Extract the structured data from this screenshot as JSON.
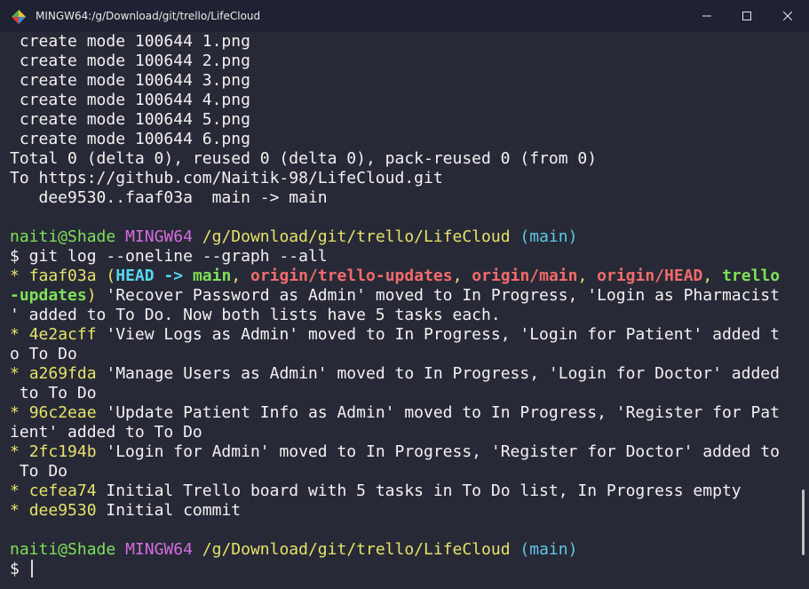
{
  "window": {
    "title": "MINGW64:/g/Download/git/trello/LifeCloud",
    "controls": {
      "minimize": "minimize",
      "maximize": "maximize",
      "close": "close"
    }
  },
  "terminal": {
    "plain_top": [
      " create mode 100644 1.png",
      " create mode 100644 2.png",
      " create mode 100644 3.png",
      " create mode 100644 4.png",
      " create mode 100644 5.png",
      " create mode 100644 6.png",
      "Total 0 (delta 0), reused 0 (delta 0), pack-reused 0 (from 0)",
      "To https://github.com/Naitik-98/LifeCloud.git",
      "   dee9530..faaf03a  main -> main"
    ],
    "prompt1": {
      "user": "naiti@Shade",
      "env": "MINGW64",
      "path": "/g/Download/git/trello/LifeCloud",
      "branch": "(main)"
    },
    "command": "$ git log --oneline --graph --all",
    "log": {
      "c1": {
        "star": "* ",
        "hash": "faaf03a",
        "open": " (",
        "head": "HEAD",
        "arrow": " -> ",
        "main": "main",
        "sep1": ", ",
        "r1": "origin/trello-updates",
        "sep2": ", ",
        "r2": "origin/main",
        "sep3": ", ",
        "r3": "origin/HEAD",
        "sep4": ", ",
        "trello_a": "trello",
        "trello_b": "-updates",
        "close": ")",
        "msg_a": " 'Recover Password as Admin' moved to In Progress, 'Login as Pharmacist",
        "msg_b": "' added to To Do. Now both lists have 5 tasks each."
      },
      "c2": {
        "star": "* ",
        "hash": "4e2acff",
        "msg_a": " 'View Logs as Admin' moved to In Progress, 'Login for Patient' added t",
        "msg_b": "o To Do"
      },
      "c3": {
        "star": "* ",
        "hash": "a269fda",
        "msg_a": " 'Manage Users as Admin' moved to In Progress, 'Login for Doctor' added",
        "msg_b": " to To Do"
      },
      "c4": {
        "star": "* ",
        "hash": "96c2eae",
        "msg_a": " 'Update Patient Info as Admin' moved to In Progress, 'Register for Pat",
        "msg_b": "ient' added to To Do"
      },
      "c5": {
        "star": "* ",
        "hash": "2fc194b",
        "msg_a": " 'Login for Admin' moved to In Progress, 'Register for Doctor' added to",
        "msg_b": " To Do"
      },
      "c6": {
        "star": "* ",
        "hash": "cefea74",
        "msg": " Initial Trello board with 5 tasks in To Do list, In Progress empty"
      },
      "c7": {
        "star": "* ",
        "hash": "dee9530",
        "msg": " Initial commit"
      }
    },
    "prompt2": {
      "user": "naiti@Shade",
      "env": "MINGW64",
      "path": "/g/Download/git/trello/LifeCloud",
      "branch": "(main)",
      "symbol": "$ "
    }
  },
  "colors": {
    "background": "#272a36",
    "titlebar": "#1f2233",
    "user": "#7fe05a",
    "env": "#d56ce0",
    "path": "#e8e26a",
    "branch": "#5ec8e8",
    "remote_ref": "#f26b6b"
  }
}
